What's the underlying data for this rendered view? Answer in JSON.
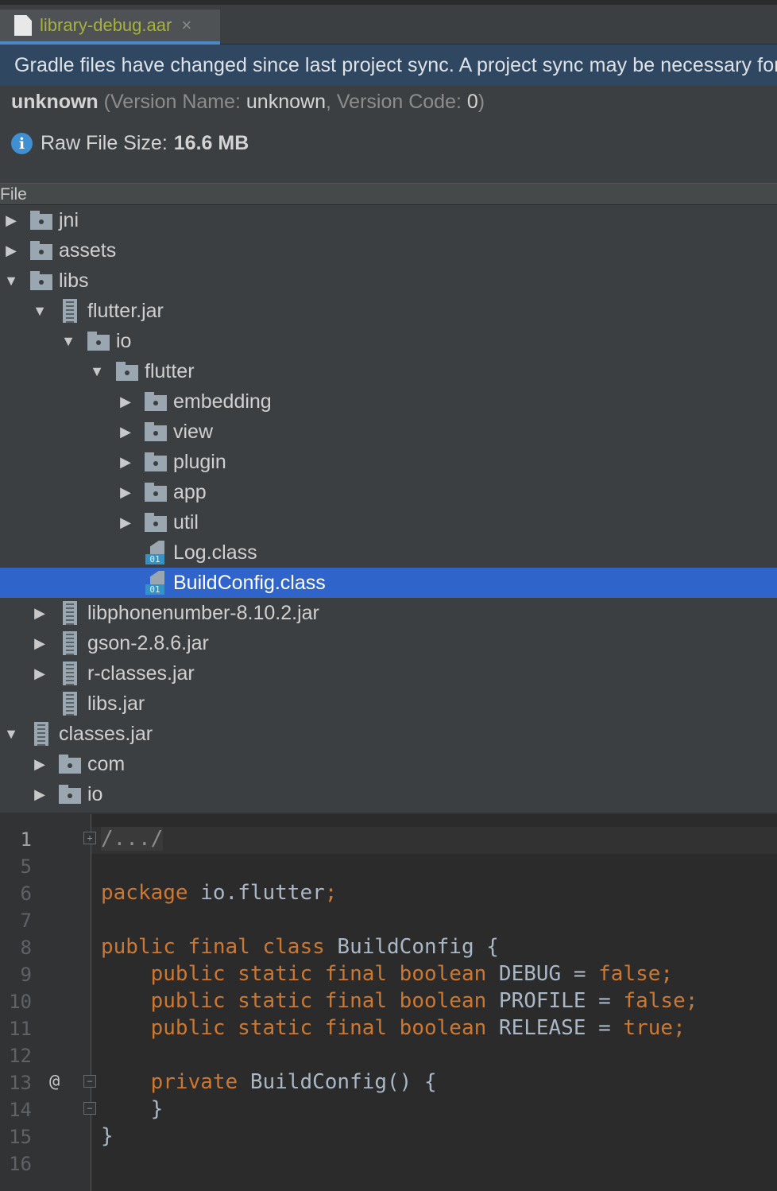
{
  "tab": {
    "label": "library-debug.aar",
    "close": "×",
    "underline_color": "#4a88c7"
  },
  "banner": {
    "text": "Gradle files have changed since last project sync. A project sync may be necessary for the IDE to work properly."
  },
  "info": {
    "app_id": "unknown",
    "version_open": " (Version Name: ",
    "version_name": "unknown",
    "version_sep": ", Version Code: ",
    "version_code": "0",
    "version_close": ")",
    "raw_size_label": "Raw File Size:",
    "raw_size_value": "16.6 MB"
  },
  "tree": {
    "header": "File",
    "rows": [
      {
        "label": "jni",
        "icon": "folder-icon",
        "arrow": "▶"
      },
      {
        "label": "assets",
        "icon": "folder-icon",
        "arrow": "▶"
      },
      {
        "label": "libs",
        "icon": "folder-icon",
        "arrow": "▼"
      },
      {
        "label": "flutter.jar",
        "icon": "jar-icon",
        "arrow": "▼"
      },
      {
        "label": "io",
        "icon": "folder-icon",
        "arrow": "▼"
      },
      {
        "label": "flutter",
        "icon": "folder-icon",
        "arrow": "▼"
      },
      {
        "label": "embedding",
        "icon": "folder-icon",
        "arrow": "▶"
      },
      {
        "label": "view",
        "icon": "folder-icon",
        "arrow": "▶"
      },
      {
        "label": "plugin",
        "icon": "folder-icon",
        "arrow": "▶"
      },
      {
        "label": "app",
        "icon": "folder-icon",
        "arrow": "▶"
      },
      {
        "label": "util",
        "icon": "folder-icon",
        "arrow": "▶"
      },
      {
        "label": "Log.class",
        "icon": "class-file-icon",
        "arrow": ""
      },
      {
        "label": "BuildConfig.class",
        "icon": "class-file-icon",
        "arrow": "",
        "selected": true
      },
      {
        "label": "libphonenumber-8.10.2.jar",
        "icon": "jar-icon",
        "arrow": "▶"
      },
      {
        "label": "gson-2.8.6.jar",
        "icon": "jar-icon",
        "arrow": "▶"
      },
      {
        "label": "r-classes.jar",
        "icon": "jar-icon",
        "arrow": "▶"
      },
      {
        "label": "libs.jar",
        "icon": "jar-icon",
        "arrow": ""
      },
      {
        "label": "classes.jar",
        "icon": "jar-icon",
        "arrow": "▼"
      },
      {
        "label": "com",
        "icon": "folder-icon",
        "arrow": "▶"
      },
      {
        "label": "io",
        "icon": "folder-icon",
        "arrow": "▶"
      }
    ],
    "class_icon_bits": "01"
  },
  "editor": {
    "line_numbers": [
      "1",
      "5",
      "6",
      "7",
      "8",
      "9",
      "10",
      "11",
      "12",
      "13",
      "14",
      "15",
      "16"
    ],
    "folded_header": "/.../",
    "code": {
      "pkg_kw": "package",
      "pkg_name": " io.flutter",
      "semicolon": ";",
      "class_kw": "public final class",
      "class_name": " BuildConfig {",
      "field_kw": "    public static final boolean",
      "debug_name": " DEBUG = ",
      "debug_val": "false;",
      "profile_name": " PROFILE = ",
      "profile_val": "false;",
      "release_name": " RELEASE = ",
      "release_val": "true;",
      "ctor_kw": "    private",
      "ctor_name": " BuildConfig() {",
      "ctor_close": "    }",
      "class_close": "}"
    },
    "override_marker": "@",
    "fold_plus": "+",
    "fold_minus": "−"
  }
}
